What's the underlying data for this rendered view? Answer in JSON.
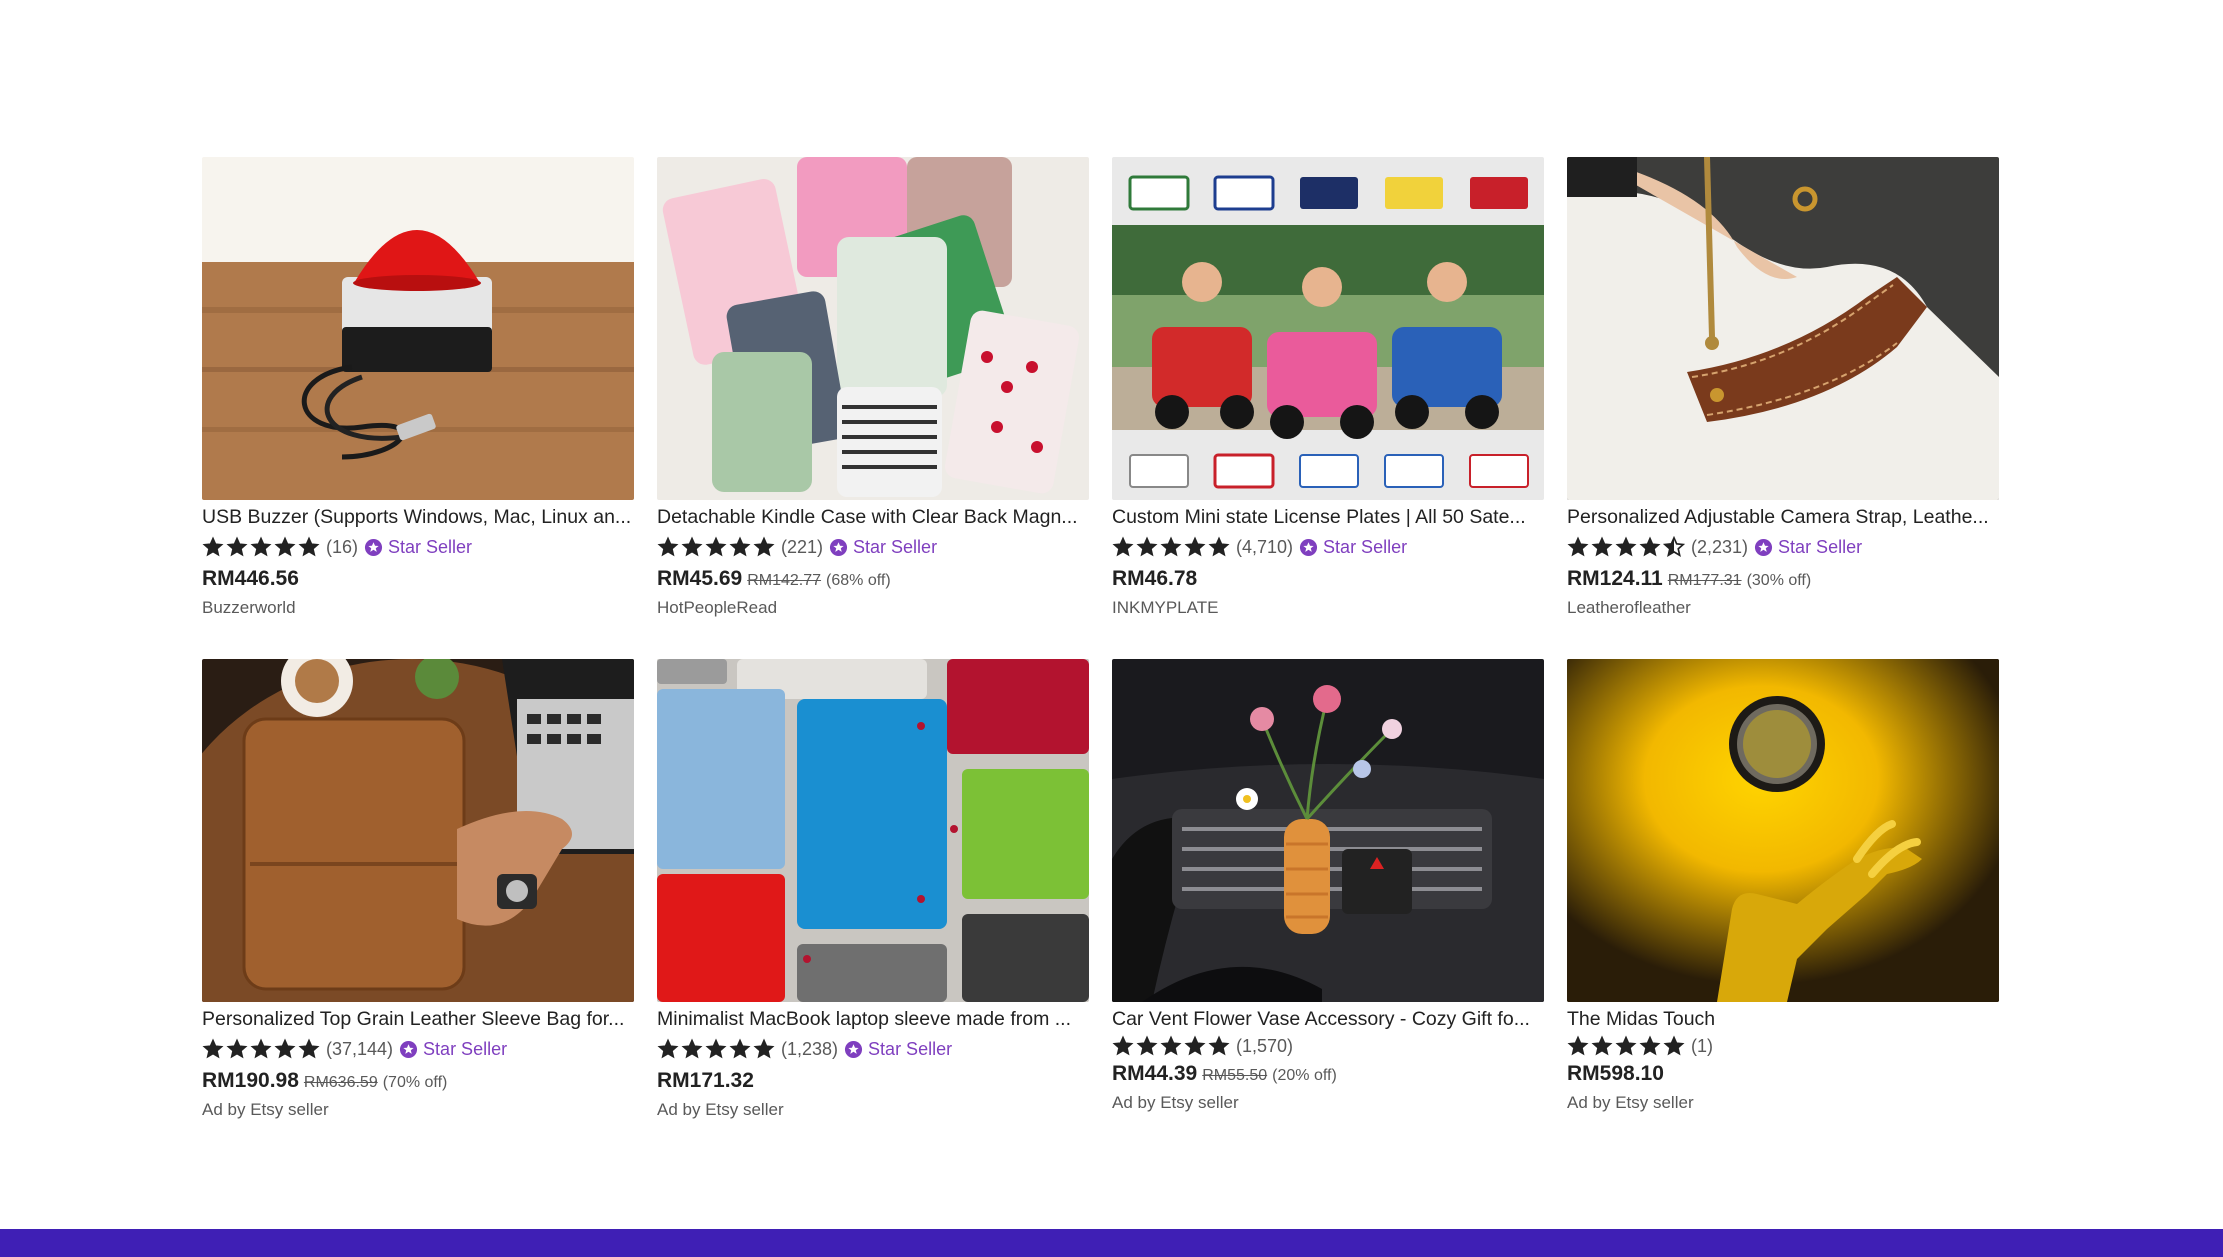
{
  "colors": {
    "footer": "#3f1fb5",
    "star_seller": "#7f3fbf",
    "text": "#222222",
    "muted": "#595959"
  },
  "products": [
    {
      "title": "USB Buzzer (Supports Windows, Mac, Linux an...",
      "stars": 5,
      "reviews": "(16)",
      "star_seller": "Star Seller",
      "price": "RM446.56",
      "original": "",
      "discount": "",
      "shop": "Buzzerworld",
      "image": "red-buzzer-image"
    },
    {
      "title": "Detachable Kindle Case with Clear Back Magn...",
      "stars": 5,
      "reviews": "(221)",
      "star_seller": "Star Seller",
      "price": "RM45.69",
      "original": "RM142.77",
      "discount": "(68% off)",
      "shop": "HotPeopleRead",
      "image": "kindle-cases-image"
    },
    {
      "title": "Custom Mini state License Plates | All 50 Sate...",
      "stars": 5,
      "reviews": "(4,710)",
      "star_seller": "Star Seller",
      "price": "RM46.78",
      "original": "",
      "discount": "",
      "shop": "INKMYPLATE",
      "image": "license-plates-image"
    },
    {
      "title": "Personalized Adjustable Camera Strap, Leathe...",
      "stars": 4.5,
      "reviews": "(2,231)",
      "star_seller": "Star Seller",
      "price": "RM124.11",
      "original": "RM177.31",
      "discount": "(30% off)",
      "shop": "Leatherofleather",
      "image": "camera-strap-image"
    },
    {
      "title": "Personalized Top Grain Leather Sleeve Bag for...",
      "stars": 5,
      "reviews": "(37,144)",
      "star_seller": "Star Seller",
      "price": "RM190.98",
      "original": "RM636.59",
      "discount": "(70% off)",
      "shop": "Ad by Etsy seller",
      "image": "leather-sleeve-image"
    },
    {
      "title": "Minimalist MacBook laptop sleeve made from ...",
      "stars": 5,
      "reviews": "(1,238)",
      "star_seller": "Star Seller",
      "price": "RM171.32",
      "original": "",
      "discount": "",
      "shop": "Ad by Etsy seller",
      "image": "felt-sleeves-image"
    },
    {
      "title": "Car Vent Flower Vase Accessory - Cozy Gift fo...",
      "stars": 5,
      "reviews": "(1,570)",
      "star_seller": "",
      "price": "RM44.39",
      "original": "RM55.50",
      "discount": "(20% off)",
      "shop": "Ad by Etsy seller",
      "image": "car-vase-image"
    },
    {
      "title": "The Midas Touch",
      "stars": 5,
      "reviews": "(1)",
      "star_seller": "",
      "price": "RM598.10",
      "original": "",
      "discount": "",
      "shop": "Ad by Etsy seller",
      "image": "midas-touch-image"
    }
  ]
}
